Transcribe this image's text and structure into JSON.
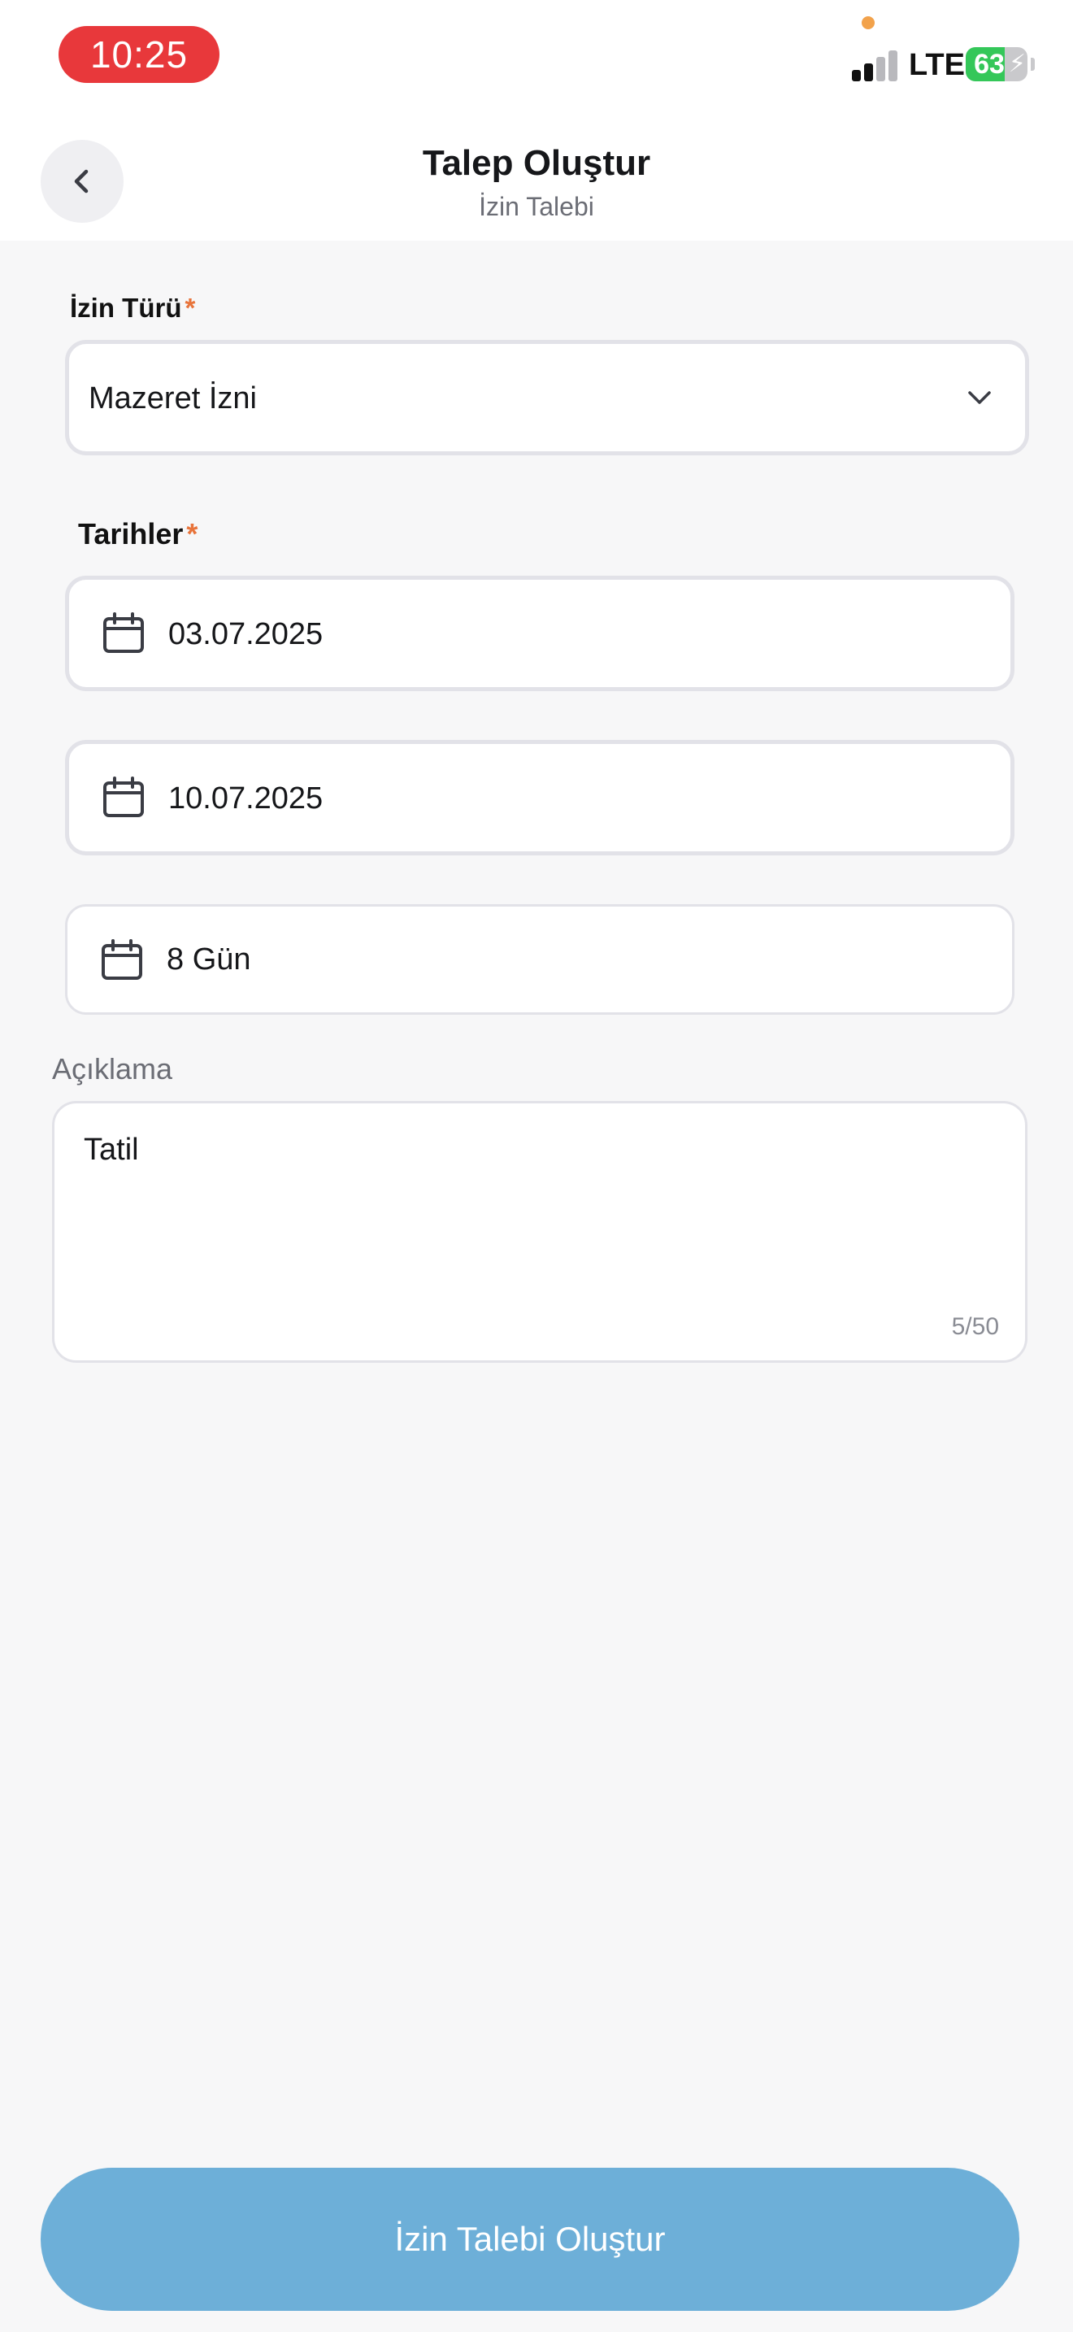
{
  "status_bar": {
    "time": "10:25",
    "network": "LTE",
    "battery_level": "63",
    "battery_percent": 63,
    "battery_color": "#34c759",
    "time_pill_color": "#e8383b",
    "icons": [
      "signal-icon",
      "battery-icon",
      "charging-bolt-icon"
    ]
  },
  "header": {
    "back_icon": "chevron-left-icon",
    "title": "Talep Oluştur",
    "subtitle": "İzin Talebi"
  },
  "form": {
    "leave_type": {
      "label": "İzin Türü",
      "required_mark": "*",
      "value": "Mazeret İzni",
      "icon": "chevron-down-icon"
    },
    "dates": {
      "label": "Tarihler",
      "required_mark": "*",
      "start_date": "03.07.2025",
      "end_date": "10.07.2025",
      "duration": "8 Gün",
      "icon": "calendar-icon"
    },
    "description": {
      "label": "Açıklama",
      "value": "Tatil",
      "counter": "5/50"
    }
  },
  "submit_button": {
    "label": "İzin Talebi Oluştur",
    "color": "#6dafd8"
  },
  "colors": {
    "required_accent": "#e8743b",
    "background": "#f7f7f8"
  }
}
